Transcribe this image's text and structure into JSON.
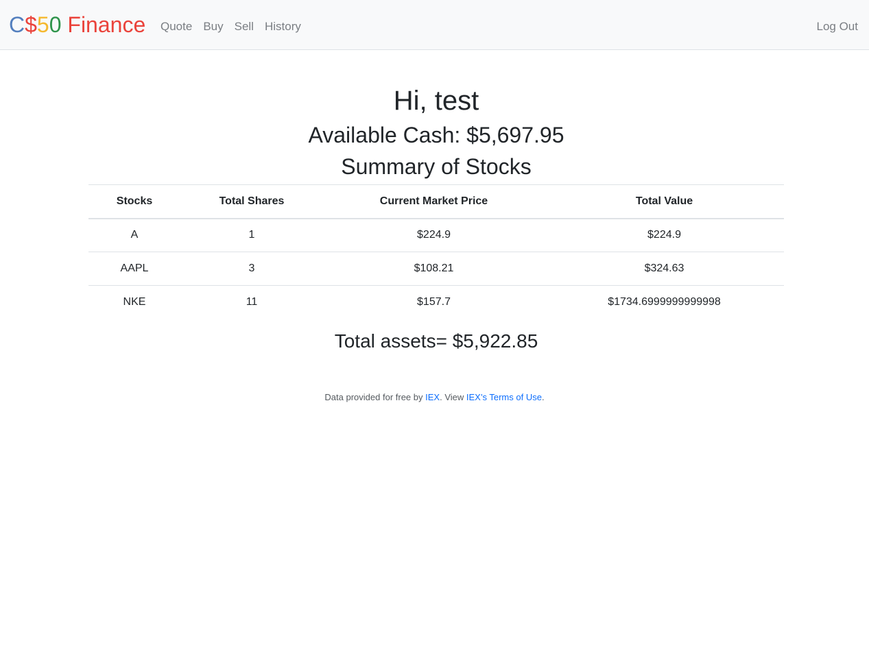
{
  "navbar": {
    "brand": {
      "c": "C",
      "dollar": "$",
      "five": "5",
      "zero": "0",
      "finance": " Finance"
    },
    "links": [
      {
        "label": "Quote"
      },
      {
        "label": "Buy"
      },
      {
        "label": "Sell"
      },
      {
        "label": "History"
      }
    ],
    "logout_label": "Log Out"
  },
  "main": {
    "greeting": "Hi, test",
    "cash": "Available Cash: $5,697.95",
    "summary_title": "Summary of Stocks",
    "table": {
      "headers": [
        "Stocks",
        "Total Shares",
        "Current Market Price",
        "Total Value"
      ],
      "rows": [
        [
          "A",
          "1",
          "$224.9",
          "$224.9"
        ],
        [
          "AAPL",
          "3",
          "$108.21",
          "$324.63"
        ],
        [
          "NKE",
          "11",
          "$157.7",
          "$1734.6999999999998"
        ]
      ]
    },
    "total_assets": "Total assets= $5,922.85"
  },
  "footer": {
    "prefix": "Data provided for free by ",
    "iex_link": "IEX",
    "middle": ". View ",
    "terms_link": "IEX’s Terms of Use",
    "suffix": "."
  }
}
